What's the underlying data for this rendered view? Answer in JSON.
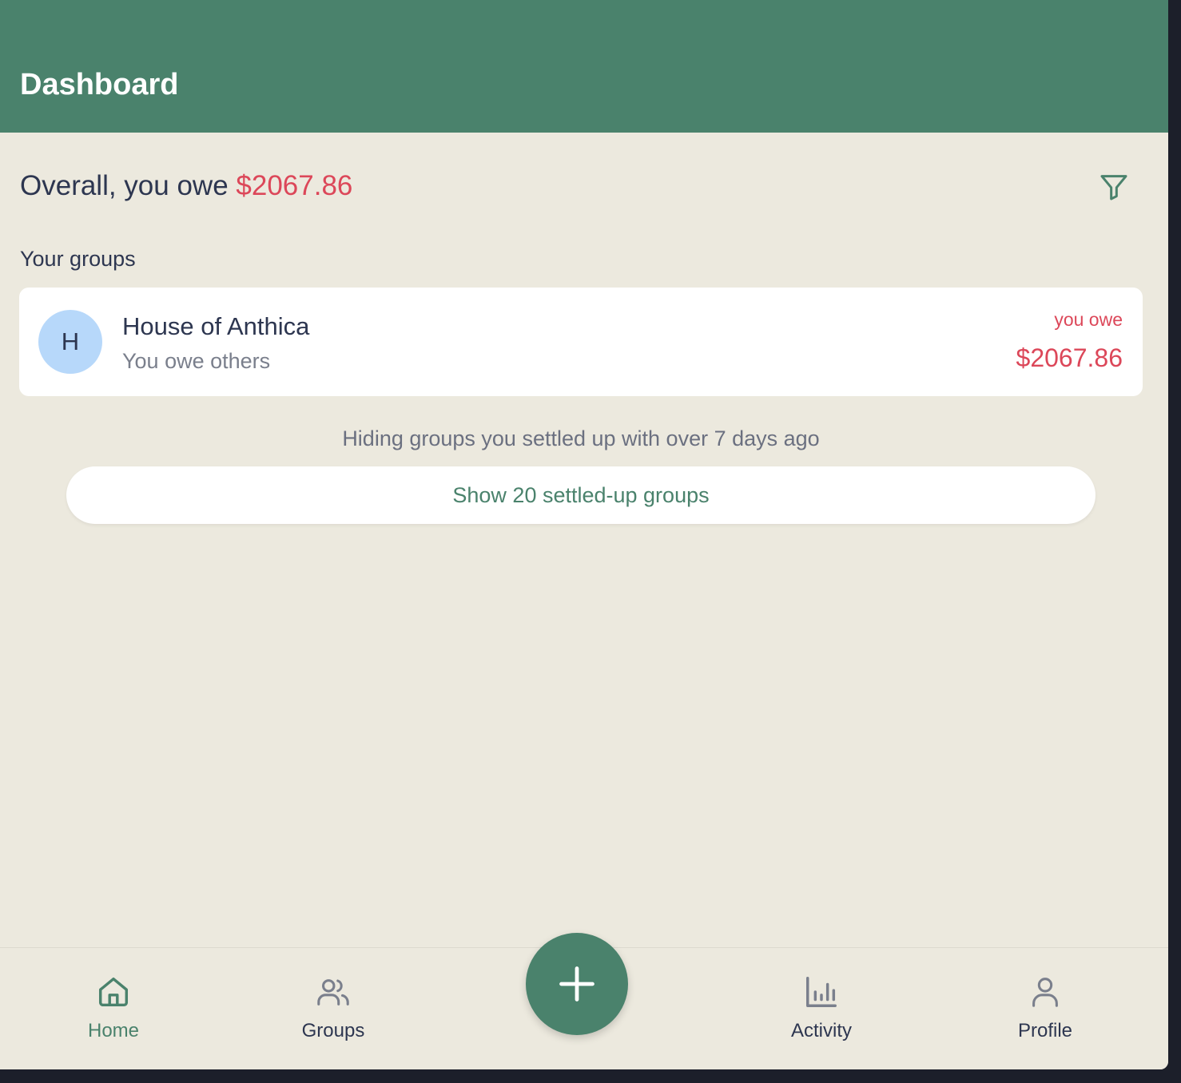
{
  "header": {
    "title": "Dashboard"
  },
  "summary": {
    "prefix": "Overall, you owe ",
    "amount": "$2067.86"
  },
  "groups_section": {
    "label": "Your groups",
    "groups": [
      {
        "initial": "H",
        "name": "House of Anthica",
        "status": "You owe others",
        "balance_label": "you owe",
        "balance_amount": "$2067.86"
      }
    ]
  },
  "settled": {
    "note": "Hiding groups you settled up with over 7 days ago",
    "button_label": "Show 20 settled-up groups"
  },
  "nav": {
    "items": [
      {
        "label": "Home",
        "icon": "home-icon",
        "active": true
      },
      {
        "label": "Groups",
        "icon": "groups-icon",
        "active": false
      },
      {
        "label": "Activity",
        "icon": "activity-icon",
        "active": false
      },
      {
        "label": "Profile",
        "icon": "profile-icon",
        "active": false
      }
    ],
    "fab_icon": "plus-icon"
  },
  "colors": {
    "brand": "#4a826c",
    "background": "#ece9de",
    "owe": "#dc4759",
    "text": "#2d3650",
    "muted": "#7a7f8c",
    "avatar": "#b7d8fa"
  }
}
